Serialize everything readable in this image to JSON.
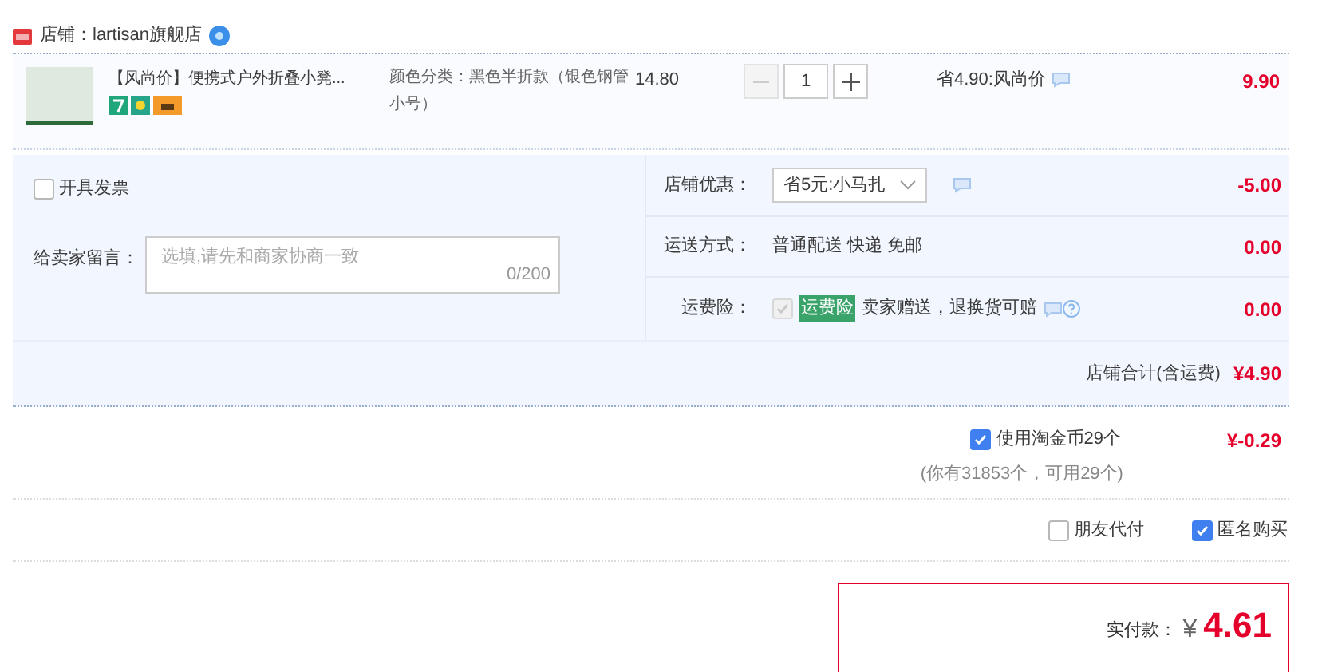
{
  "shop": {
    "label": "店铺：lartisan旗舰店"
  },
  "item": {
    "title": "【风尚价】便携式户外折叠小凳...",
    "spec": "颜色分类：黑色半折款（银色钢管小号）",
    "unit_price": "14.80",
    "quantity": "1",
    "minus_disabled": true,
    "promo": "省4.90:风尚价",
    "total": "9.90"
  },
  "invoice": {
    "label": "开具发票",
    "checked": false
  },
  "message": {
    "label": "给卖家留言：",
    "placeholder": "选填,请先和商家协商一致",
    "counter": "0/200"
  },
  "order_rows": [
    {
      "kind": "select",
      "label": "店铺优惠：",
      "value": "省5元:小马扎",
      "amount": "-5.00"
    },
    {
      "kind": "text",
      "label": "运送方式：",
      "value": "普通配送 快递 免邮",
      "amount": "0.00"
    },
    {
      "kind": "insurance",
      "label": "运费险：",
      "badge": "运费险",
      "value": "卖家赠送，退换货可赔",
      "checked": true,
      "disabled": true,
      "amount": "0.00"
    }
  ],
  "shop_total": {
    "label": "店铺合计(含运费)",
    "value": "¥4.90"
  },
  "coins": {
    "label": "使用淘金币29个",
    "checked": true,
    "note": "(你有31853个，可用29个)",
    "amount": "¥-0.29"
  },
  "extra_options": [
    {
      "label": "朋友代付",
      "checked": false
    },
    {
      "label": "匿名购买",
      "checked": true
    }
  ],
  "payment": {
    "label": "实付款：",
    "currency": "¥",
    "amount": "4.61"
  }
}
